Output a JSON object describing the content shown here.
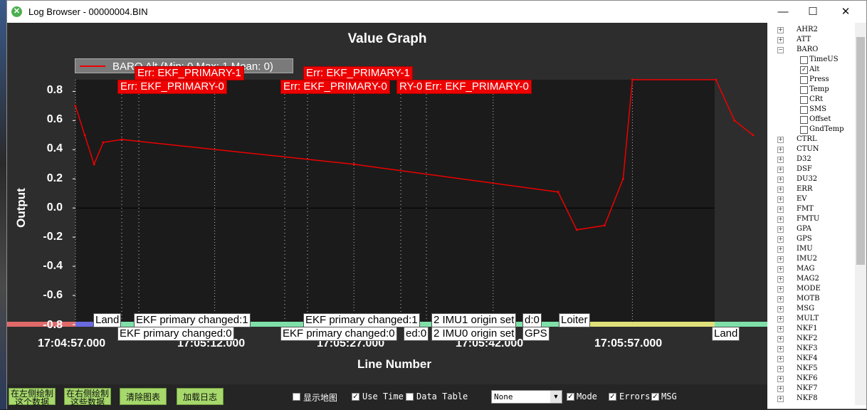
{
  "window": {
    "title": "Log Browser - 00000004.BIN",
    "minimize": "—",
    "maximize": "☐",
    "close": "✕"
  },
  "graph": {
    "title": "Value Graph",
    "x_axis_label": "Line Number",
    "y_axis_label": "Output",
    "legend": "BARO Alt (Min: 0 Max: 1 Mean: 0)",
    "y_ticks": [
      "0.8",
      "0.6",
      "0.4",
      "0.2",
      "0.0",
      "-0.2",
      "-0.4",
      "-0.6",
      "-0.8"
    ],
    "x_ticks": [
      "17:04:57.000",
      "17:05:12.000",
      "17:05:27.000",
      "17:05:42.000",
      "17:05:57.000"
    ]
  },
  "chart_data": {
    "type": "line",
    "title": "Value Graph",
    "xlabel": "Line Number",
    "ylabel": "Output",
    "ylim": [
      -0.8,
      0.88
    ],
    "series": [
      {
        "name": "BARO Alt",
        "color": "#ee0000",
        "x": [
          "17:04:57",
          "17:04:58",
          "17:04:59",
          "17:05:00",
          "17:05:02",
          "17:05:27",
          "17:05:49",
          "17:05:51",
          "17:05:54",
          "17:05:56",
          "17:05:57",
          "17:06:06",
          "17:06:08",
          "17:06:10"
        ],
        "y": [
          0.7,
          0.5,
          0.3,
          0.45,
          0.47,
          0.3,
          0.11,
          -0.15,
          -0.12,
          0.2,
          0.88,
          0.88,
          0.6,
          0.5
        ]
      }
    ]
  },
  "errors": [
    "Err: EKF_PRIMARY-1",
    "Err: EKF_PRIMARY-0",
    "Err: EKF_PRIMARY-1",
    "Err: EKF_PRIMARY-0",
    "RY-0",
    "Err: EKF_PRIMARY-0"
  ],
  "events": [
    "Land",
    "EKF primary changed:1",
    "EKF primary changed:0",
    "EKF primary changed:1",
    "EKF primary changed:0",
    "ed:0",
    "2 IMU1 origin set",
    "2 IMU0 origin set",
    "d:0",
    "GPS",
    "Loiter",
    "Land"
  ],
  "bottom": {
    "btn1": "在左侧绘制这个数据",
    "btn2": "在右侧绘制这些数据",
    "btn3": "清除图表",
    "btn4": "加载日志",
    "show_map": "显示地图",
    "use_time": "Use Time",
    "data_table": "Data Table",
    "dropdown_value": "None",
    "mode": "Mode",
    "errors": "Errors",
    "msg": "MSG"
  },
  "tree": {
    "items": [
      "AHR2",
      "ATT",
      "BARO",
      "TimeUS",
      "Alt",
      "Press",
      "Temp",
      "CRt",
      "SMS",
      "Offset",
      "GndTemp",
      "CTRL",
      "CTUN",
      "D32",
      "DSF",
      "DU32",
      "ERR",
      "EV",
      "FMT",
      "FMTU",
      "GPA",
      "GPS",
      "IMU",
      "IMU2",
      "MAG",
      "MAG2",
      "MODE",
      "MOTB",
      "MSG",
      "MULT",
      "NKF1",
      "NKF2",
      "NKF3",
      "NKF4",
      "NKF5",
      "NKF6",
      "NKF7",
      "NKF8"
    ]
  }
}
